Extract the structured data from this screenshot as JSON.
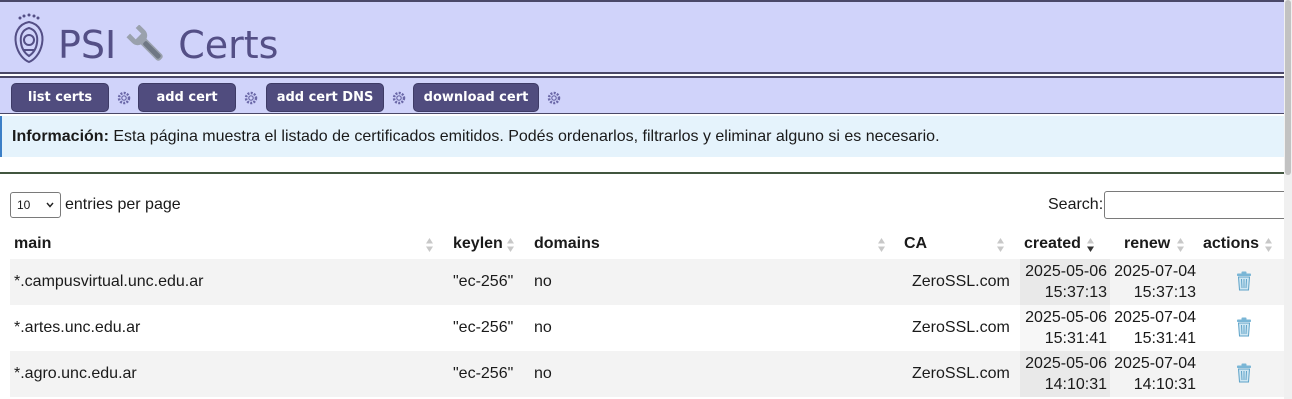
{
  "header": {
    "title_psi": "PSI",
    "title_certs": "Certs"
  },
  "nav": {
    "buttons": [
      {
        "label": "list certs"
      },
      {
        "label": "add cert"
      },
      {
        "label": "add cert DNS"
      },
      {
        "label": "download cert"
      }
    ]
  },
  "info": {
    "label": "Información:",
    "text": " Esta página muestra el listado de certificados emitidos. Podés ordenarlos, filtrarlos y eliminar alguno si es necesario."
  },
  "table_controls": {
    "page_length_value": "10",
    "page_length_label": "entries per page",
    "search_label": "Search:",
    "search_value": ""
  },
  "table": {
    "columns": [
      "main",
      "keylen",
      "domains",
      "CA",
      "created",
      "renew",
      "actions"
    ],
    "sorted_column": "created",
    "sort_direction": "descending",
    "rows": [
      {
        "main": "*.campusvirtual.unc.edu.ar",
        "keylen": "\"ec-256\"",
        "domains": "no",
        "ca": "ZeroSSL.com",
        "created_date": "2025-05-06",
        "created_time": "15:37:13",
        "renew_date": "2025-07-04",
        "renew_time": "15:37:13",
        "action_icon": "trash-icon"
      },
      {
        "main": "*.artes.unc.edu.ar",
        "keylen": "\"ec-256\"",
        "domains": "no",
        "ca": "ZeroSSL.com",
        "created_date": "2025-05-06",
        "created_time": "15:31:41",
        "renew_date": "2025-07-04",
        "renew_time": "15:31:41",
        "action_icon": "trash-icon"
      },
      {
        "main": "*.agro.unc.edu.ar",
        "keylen": "\"ec-256\"",
        "domains": "no",
        "ca": "ZeroSSL.com",
        "created_date": "2025-05-06",
        "created_time": "14:10:31",
        "renew_date": "2025-07-04",
        "renew_time": "14:10:31",
        "action_icon": "trash-icon"
      }
    ]
  },
  "colors": {
    "header_bg": "#d0d3fa",
    "button_bg": "#504c7e",
    "title_color": "#544f86",
    "info_bg": "#e5f3fc",
    "info_accent": "#3c7fc7"
  }
}
